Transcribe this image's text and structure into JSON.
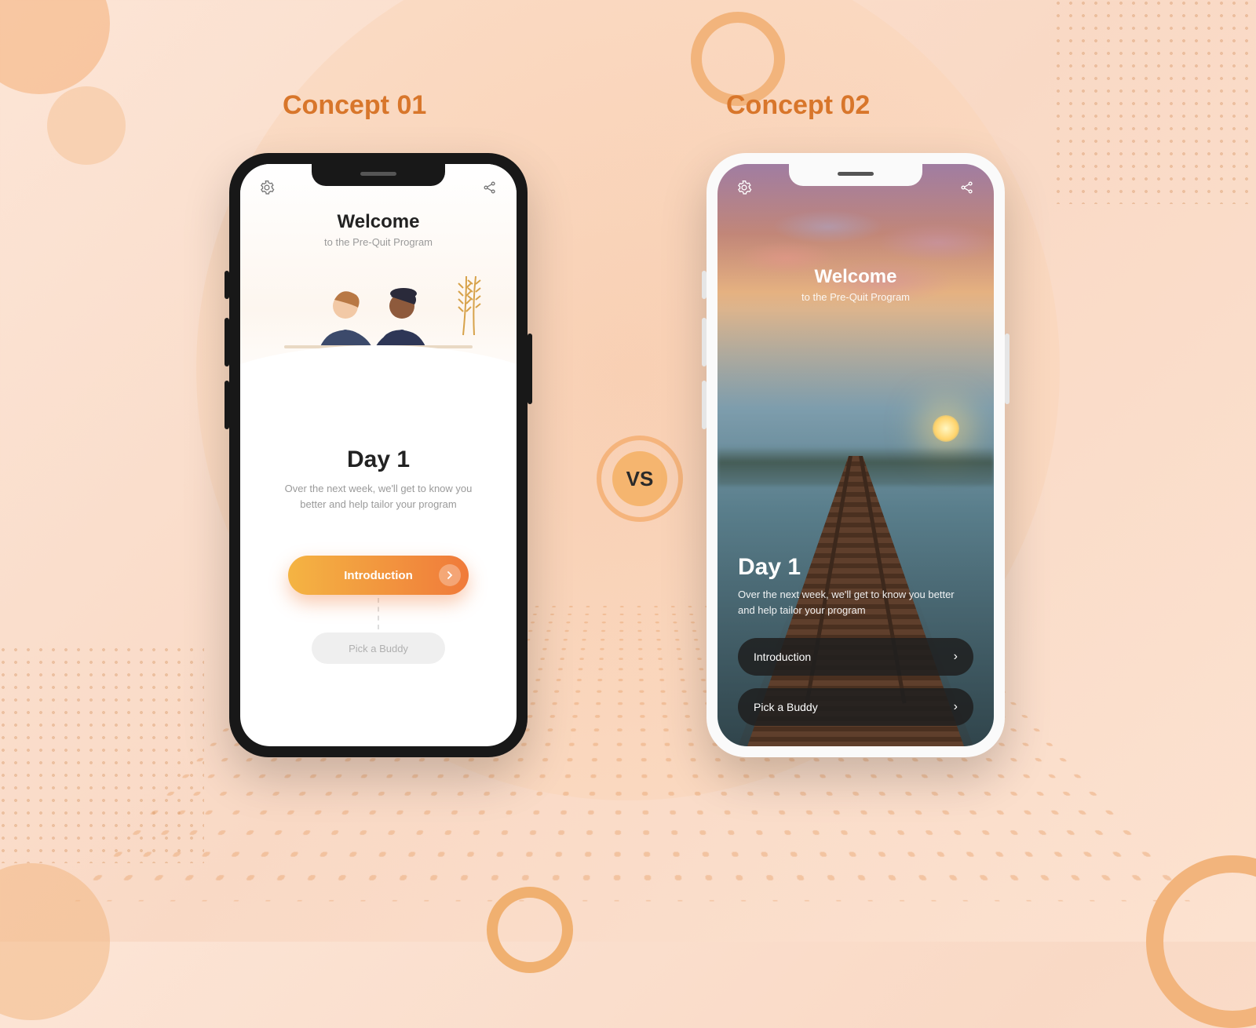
{
  "labels": {
    "concept1": "Concept 01",
    "concept2": "Concept 02",
    "vs": "VS"
  },
  "concept1": {
    "welcome_title": "Welcome",
    "welcome_sub": "to the Pre-Quit Program",
    "day_title": "Day 1",
    "day_desc": "Over the next week, we'll get to know you better and help tailor your program",
    "primary_btn": "Introduction",
    "secondary_btn": "Pick a Buddy",
    "icons": {
      "settings": "gear-icon",
      "share": "share-icon"
    }
  },
  "concept2": {
    "welcome_title": "Welcome",
    "welcome_sub": "to the Pre-Quit Program",
    "day_title": "Day 1",
    "day_desc": "Over the next week, we'll get to know you better and help tailor your program",
    "buttons": [
      {
        "label": "Introduction"
      },
      {
        "label": "Pick a Buddy"
      }
    ],
    "icons": {
      "settings": "gear-icon",
      "share": "share-icon"
    }
  },
  "colors": {
    "accent": "#d8762b",
    "gradient_start": "#f4b443",
    "gradient_end": "#f07a3a"
  }
}
